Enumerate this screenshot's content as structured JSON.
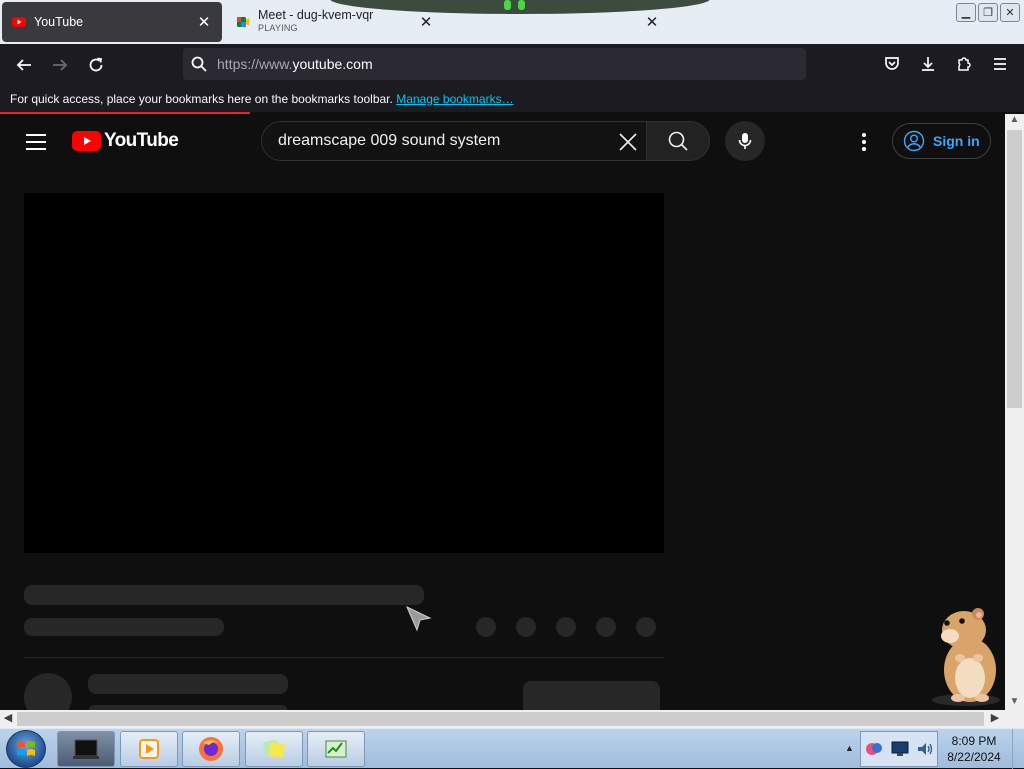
{
  "browser": {
    "tabs": [
      {
        "title": "YouTube",
        "subtitle": "",
        "active": true
      },
      {
        "title": "Meet - dug-kvem-vqr",
        "subtitle": "PLAYING",
        "active": false
      },
      {
        "title": "",
        "subtitle": "",
        "active": false
      }
    ],
    "url_prefix": "https://www.",
    "url_domain": "youtube.com",
    "bookmarks_message": "For quick access, place your bookmarks here on the bookmarks toolbar.",
    "manage_bookmarks_label": "Manage bookmarks…"
  },
  "youtube": {
    "logo_text": "YouTube",
    "search_value": "dreamscape 009 sound system",
    "sign_in_label": "Sign in"
  },
  "taskbar": {
    "time": "8:09 PM",
    "date": "8/22/2024"
  },
  "colors": {
    "youtube_red": "#ff0000",
    "page_bg": "#0f0f0f",
    "skeleton": "#272727",
    "link_blue": "#3ea6ff",
    "browser_toolbar": "#1c1b22"
  }
}
